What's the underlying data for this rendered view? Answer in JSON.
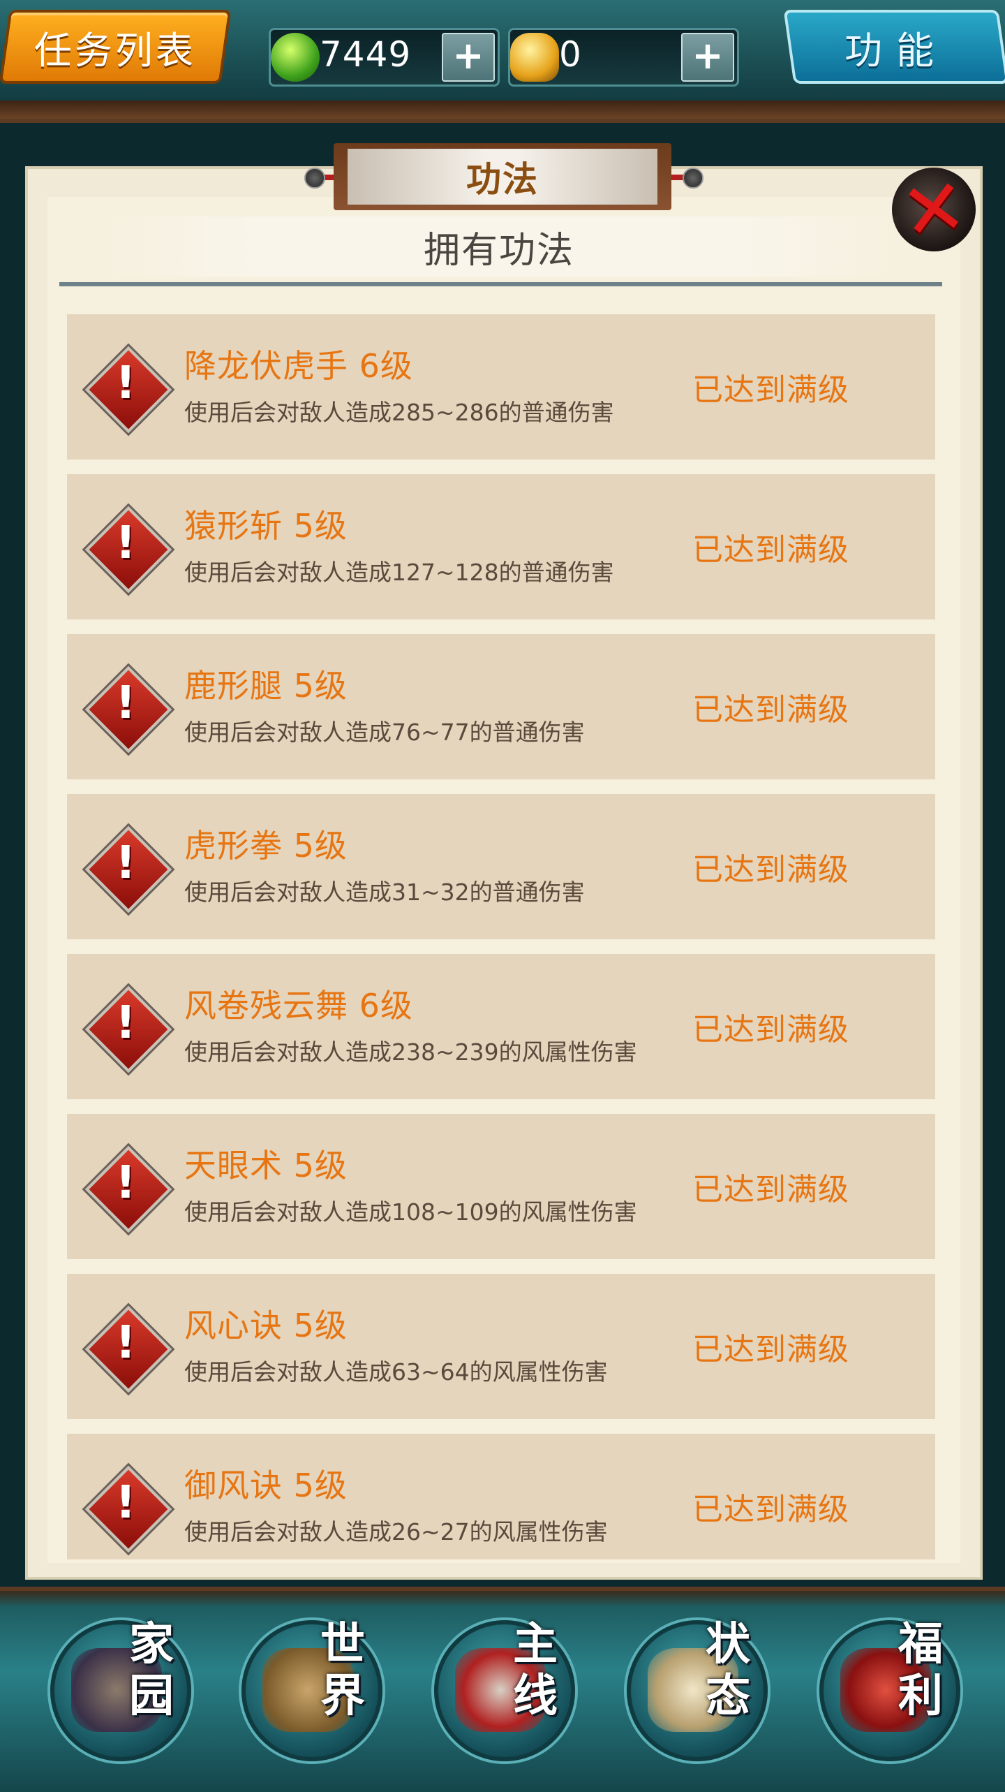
{
  "topbar": {
    "task_list_label": "任务列表",
    "function_label": "功能",
    "currencies": [
      {
        "icon": "jade-coin-icon",
        "value": "7449",
        "add_label": "+"
      },
      {
        "icon": "gold-ingot-icon",
        "value": "0",
        "add_label": "+"
      }
    ]
  },
  "panel": {
    "title": "功法",
    "subtitle": "拥有功法",
    "close_icon": "close-x-icon",
    "skills": [
      {
        "name": "降龙伏虎手",
        "level": "6级",
        "desc": "使用后会对敌人造成285~286的普通伤害",
        "status": "已达到满级"
      },
      {
        "name": "猿形斩",
        "level": "5级",
        "desc": "使用后会对敌人造成127~128的普通伤害",
        "status": "已达到满级"
      },
      {
        "name": "鹿形腿",
        "level": "5级",
        "desc": "使用后会对敌人造成76~77的普通伤害",
        "status": "已达到满级"
      },
      {
        "name": "虎形拳",
        "level": "5级",
        "desc": "使用后会对敌人造成31~32的普通伤害",
        "status": "已达到满级"
      },
      {
        "name": "风卷残云舞",
        "level": "6级",
        "desc": "使用后会对敌人造成238~239的风属性伤害",
        "status": "已达到满级"
      },
      {
        "name": "天眼术",
        "level": "5级",
        "desc": "使用后会对敌人造成108~109的风属性伤害",
        "status": "已达到满级"
      },
      {
        "name": "风心诀",
        "level": "5级",
        "desc": "使用后会对敌人造成63~64的风属性伤害",
        "status": "已达到满级"
      },
      {
        "name": "御风诀",
        "level": "5级",
        "desc": "使用后会对敌人造成26~27的风属性伤害",
        "status": "已达到满级"
      }
    ]
  },
  "bottomnav": {
    "items": [
      {
        "label": "家园",
        "icon": "home-icon"
      },
      {
        "label": "世界",
        "icon": "world-map-icon"
      },
      {
        "label": "主线",
        "icon": "main-quest-icon"
      },
      {
        "label": "状态",
        "icon": "status-bagua-icon"
      },
      {
        "label": "福利",
        "icon": "welfare-bag-icon"
      }
    ]
  },
  "colors": {
    "accent_orange": "#e67512",
    "row_bg": "#e5d5bd",
    "panel_bg": "#f0ead6",
    "teal_frame": "#1a4d52"
  }
}
